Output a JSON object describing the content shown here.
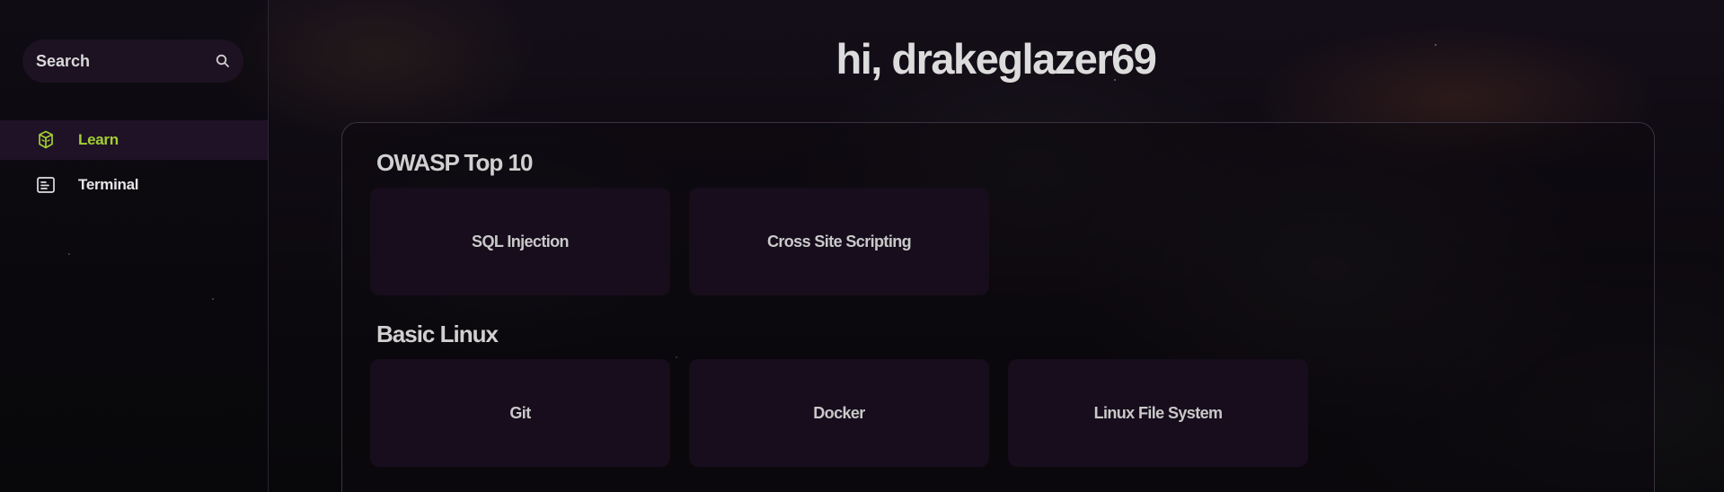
{
  "sidebar": {
    "search": {
      "label": "Search",
      "icon": "search-icon"
    },
    "items": [
      {
        "label": "Learn",
        "icon": "book-stack-icon",
        "active": true
      },
      {
        "label": "Terminal",
        "icon": "terminal-window-icon",
        "active": false
      }
    ]
  },
  "main": {
    "greeting": "hi, drakeglazer69",
    "sections": [
      {
        "title": "OWASP Top 10",
        "cards": [
          {
            "label": "SQL Injection"
          },
          {
            "label": "Cross Site Scripting"
          }
        ]
      },
      {
        "title": "Basic Linux",
        "cards": [
          {
            "label": "Git"
          },
          {
            "label": "Docker"
          },
          {
            "label": "Linux File System"
          }
        ]
      }
    ]
  },
  "colors": {
    "accent": "#a3cf33",
    "sidebar_active_bg": "#1f1226",
    "card_bg": "#170d1c",
    "search_bg": "#1d1222"
  }
}
